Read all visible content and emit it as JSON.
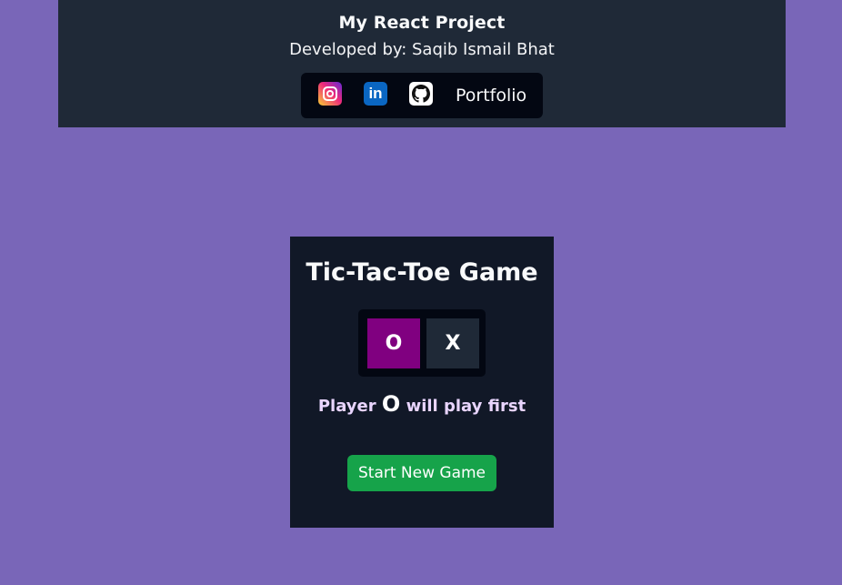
{
  "header": {
    "title": "My React Project",
    "subtitle": "Developed by: Saqib Ismail Bhat",
    "social": {
      "instagram_icon": "instagram-icon",
      "linkedin_icon": "linkedin-icon",
      "linkedin_glyph": "in",
      "github_icon": "github-icon",
      "portfolio_label": "Portfolio"
    },
    "colors": {
      "background": "#1f2937",
      "bar": "#030712"
    }
  },
  "game": {
    "title": "Tic-Tac-Toe Game",
    "toggle": {
      "options": [
        "O",
        "X"
      ],
      "selected": "O",
      "selected_color": "#800080"
    },
    "first_player": {
      "prefix": "Player",
      "mark": "O",
      "suffix": "will play first"
    },
    "start_button_label": "Start New Game",
    "colors": {
      "card": "#111827",
      "start_button": "#16a34a"
    }
  },
  "page": {
    "background": "#7966b8"
  }
}
